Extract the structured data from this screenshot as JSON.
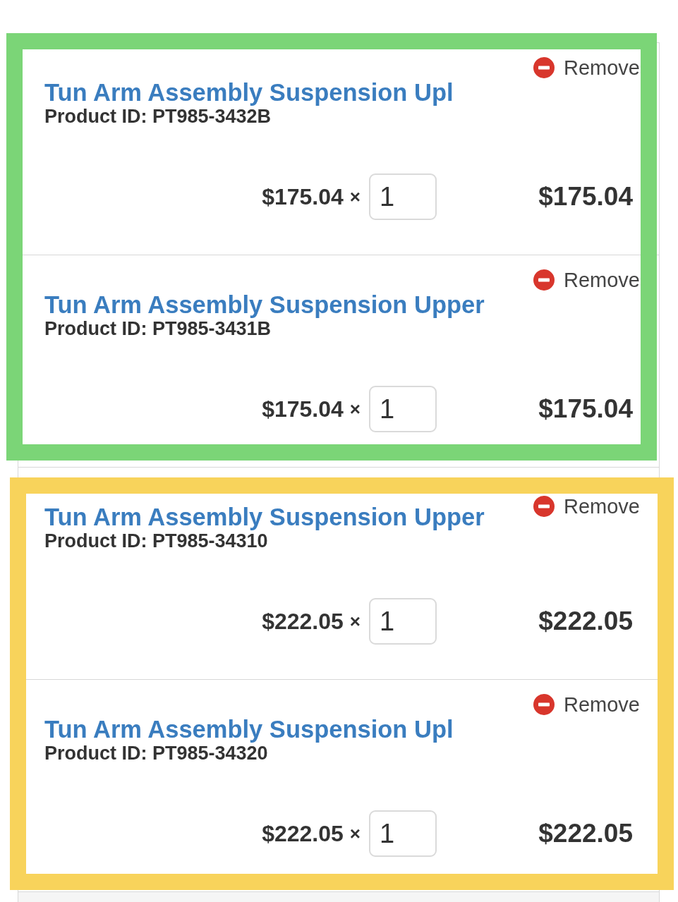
{
  "cart": {
    "groups": [
      {
        "color": "#7bd577",
        "items": [
          {
            "remove": "Remove",
            "title": "Tun Arm Assembly Suspension Upl",
            "product_id": "Product ID: PT985-3432B",
            "unit_price": "$175.04",
            "times": "×",
            "quantity": "1",
            "total": "$175.04"
          },
          {
            "remove": "Remove",
            "title": "Tun Arm Assembly Suspension Upper",
            "product_id": "Product ID: PT985-3431B",
            "unit_price": "$175.04",
            "times": "×",
            "quantity": "1",
            "total": "$175.04"
          }
        ]
      },
      {
        "color": "#f8d35b",
        "items": [
          {
            "remove": "Remove",
            "title": "Tun Arm Assembly Suspension Upper",
            "product_id": "Product ID: PT985-34310",
            "unit_price": "$222.05",
            "times": "×",
            "quantity": "1",
            "total": "$222.05"
          },
          {
            "remove": "Remove",
            "title": "Tun Arm Assembly Suspension Upl",
            "product_id": "Product ID: PT985-34320",
            "unit_price": "$222.05",
            "times": "×",
            "quantity": "1",
            "total": "$222.05"
          }
        ]
      }
    ]
  }
}
